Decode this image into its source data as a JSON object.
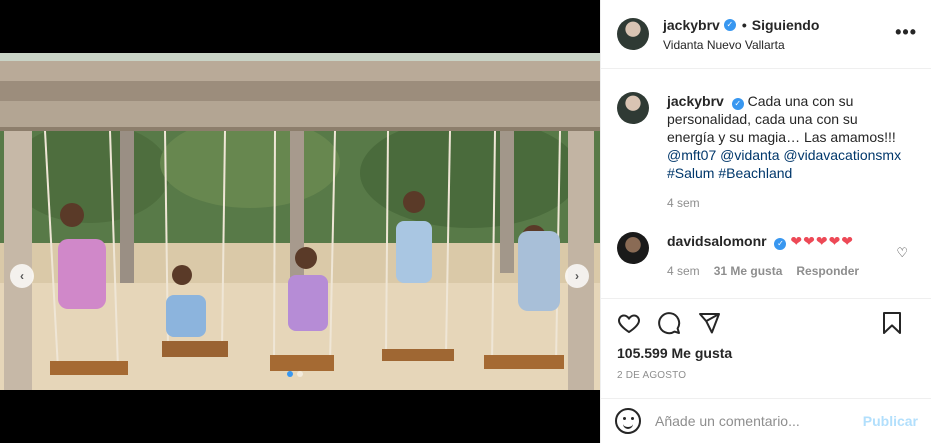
{
  "post": {
    "username": "jackybrv",
    "follow_status": "Siguiendo",
    "bullet": "•",
    "location": "Vidanta Nuevo Vallarta",
    "more_icon": "more-horizontal-icon"
  },
  "caption": {
    "username": "jackybrv",
    "text": "Cada una con su personalidad, cada una con su energía y su magia… Las amamos!!! ",
    "mentions": [
      "@mft07",
      "@vidanta",
      "@vidavacationsmx",
      "#Salum",
      "#Beachland"
    ],
    "time": "4 sem"
  },
  "comment": {
    "username": "davidsalomonr",
    "text": "❤❤❤❤❤",
    "time": "4 sem",
    "likes": "31 Me gusta",
    "reply": "Responder"
  },
  "actions": {
    "likes": "105.599 Me gusta",
    "date": "2 DE AGOSTO"
  },
  "composer": {
    "placeholder": "Añade un comentario...",
    "post_label": "Publicar"
  },
  "carousel": {
    "prev": "‹",
    "next": "›",
    "slides": 2,
    "active": 1
  },
  "colors": {
    "verified": "#3897f0",
    "link": "#00376b",
    "heart": "#ed4956",
    "publish_disabled": "#b2dffc"
  }
}
